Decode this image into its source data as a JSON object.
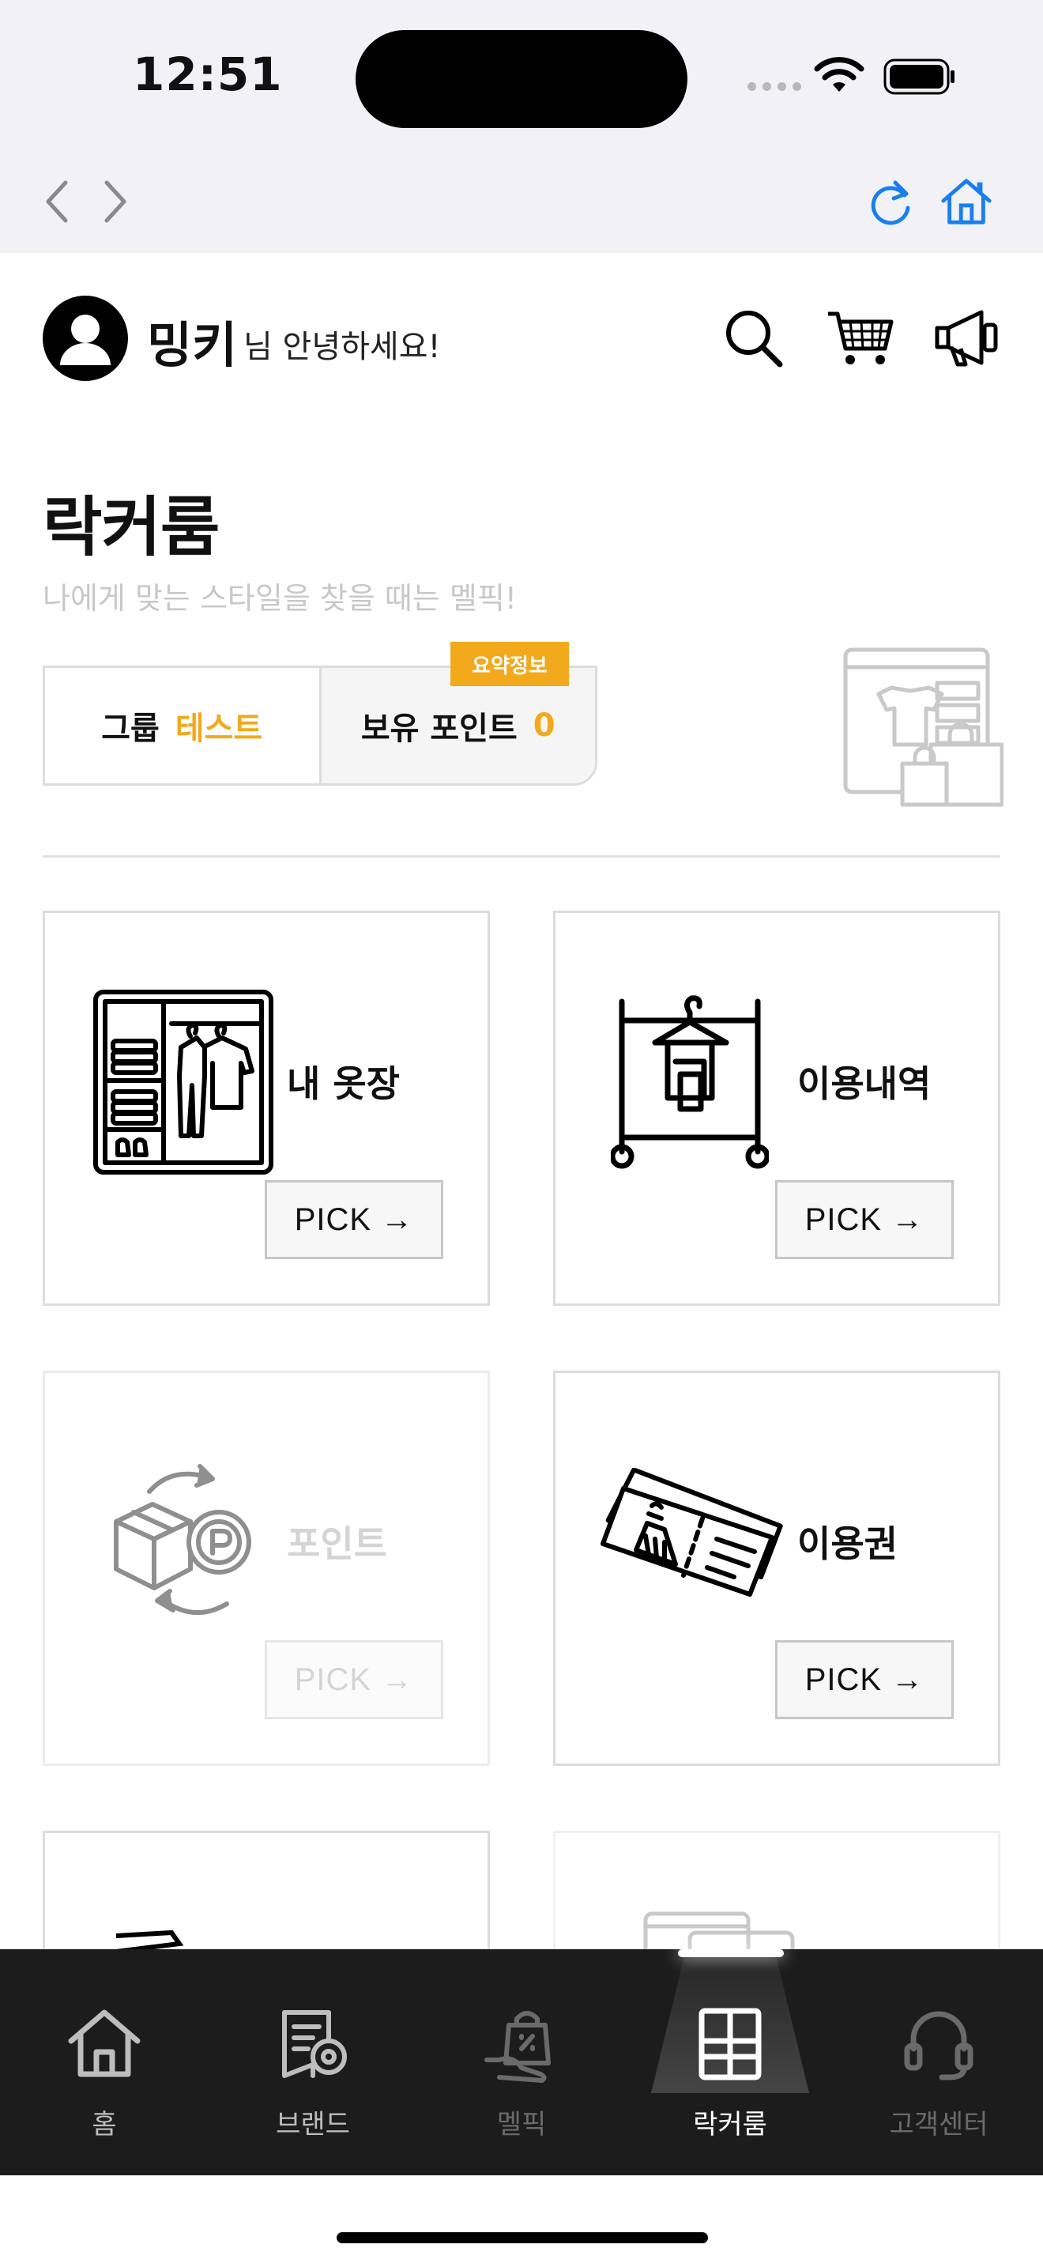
{
  "status_bar": {
    "time": "12:51"
  },
  "header": {
    "username": "밍키",
    "greeting": "님 안녕하세요!"
  },
  "page": {
    "title": "락커룸",
    "subtitle": "나에게 맞는 스타일을 찾을 때는 멜픽!"
  },
  "info": {
    "badge": "요약정보",
    "group_label": "그룹",
    "group_value": "테스트",
    "points_label": "보유 포인트",
    "points_value": "0"
  },
  "cards": [
    {
      "label": "내 옷장",
      "pick": "PICK →",
      "icon": "wardrobe-icon",
      "enabled": true
    },
    {
      "label": "이용내역",
      "pick": "PICK →",
      "icon": "clothing-rack-icon",
      "enabled": true
    },
    {
      "label": "포인트",
      "pick": "PICK →",
      "icon": "point-exchange-icon",
      "enabled": false
    },
    {
      "label": "이용권",
      "pick": "PICK →",
      "icon": "ticket-icon",
      "enabled": true
    }
  ],
  "tabbar": {
    "items": [
      {
        "label": "홈",
        "icon": "home-icon",
        "active": false,
        "enabled": true
      },
      {
        "label": "브랜드",
        "icon": "brand-icon",
        "active": false,
        "enabled": true
      },
      {
        "label": "멜픽",
        "icon": "melpick-bag-icon",
        "active": false,
        "enabled": false
      },
      {
        "label": "락커룸",
        "icon": "locker-icon",
        "active": true,
        "enabled": true
      },
      {
        "label": "고객센터",
        "icon": "headset-icon",
        "active": false,
        "enabled": false
      }
    ]
  },
  "colors": {
    "accent": "#f2a91c",
    "browser_blue": "#1a7ef0",
    "tabbar_bg": "#1c1c1c"
  }
}
